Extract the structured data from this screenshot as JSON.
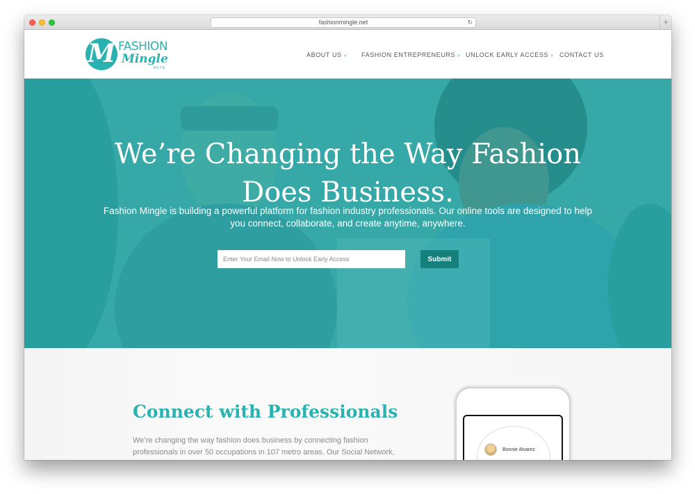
{
  "browser": {
    "url": "fashionmingle.net"
  },
  "logo": {
    "mark": "M",
    "word1": "FASHION",
    "word2": "Mingle",
    "badge": "BETA"
  },
  "nav": {
    "items": [
      {
        "label": "ABOUT US",
        "has_dropdown": true
      },
      {
        "label": "FASHION ENTREPRENEURS",
        "has_dropdown": true
      },
      {
        "label": "UNLOCK EARLY ACCESS",
        "has_dropdown": true
      },
      {
        "label": "CONTACT US",
        "has_dropdown": false
      }
    ],
    "chevron": "»"
  },
  "hero": {
    "title_line1": "We’re Changing the Way Fashion",
    "title_line2": "Does Business.",
    "subtitle": "Fashion Mingle is building a powerful platform for fashion industry professionals. Our online tools are designed to help you connect, collaborate, and create anytime, anywhere.",
    "email_placeholder": "Enter Your Email Now to Unlock Early Access",
    "submit_label": "Submit"
  },
  "section": {
    "title": "Connect with Professionals",
    "body": "We’re changing the way fashion does business by connecting fashion professionals in over 50 occupations in 107 metro areas. Our Social Network,"
  },
  "phone": {
    "profile_name": "Bonnie Alvarez"
  },
  "colors": {
    "accent": "#2ab2b0",
    "button": "#16807d",
    "nav_text": "#555555",
    "body_text": "#8a8a8a"
  },
  "icons": [
    "reload-icon",
    "new-tab-icon",
    "chevron-down-icon",
    "avatar"
  ]
}
